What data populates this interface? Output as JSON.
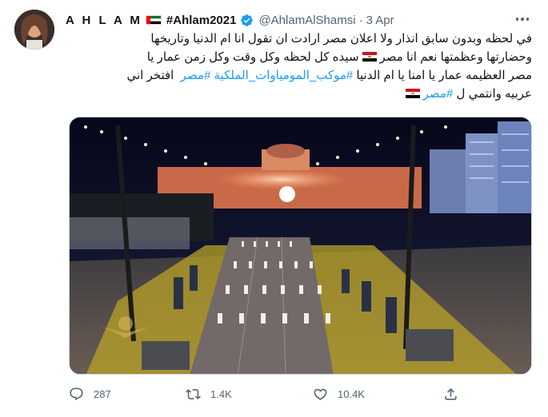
{
  "author": {
    "display_name": "A H L A M",
    "name_hashtag": "#Ahlam2021",
    "handle": "@AhlamAlShamsi",
    "date": "3 Apr",
    "verified": true
  },
  "tweet": {
    "line1": "في لحظه وبدون سابق انذار ولا اعلان مصر ارادت  ان تقول انا ام الدنيا وتاريخها",
    "line2a": "وحضارتها وعظمتها نعم انا مصر",
    "line2b": "سيده كل لحظه وكل وقت وكل زمن عمار يا",
    "line3a": "مصر العظيمه عمار يا امنا يا ام الدنيا",
    "line3_tag1": "#موكب_المومياوات_الملكية",
    "line3_tag2": "#مصر",
    "line3b": "افتخر اني",
    "line4a": "عربيه وانتمي ل",
    "line4_tag": "#مصر"
  },
  "media": {
    "type": "photo",
    "description_icon": "photo"
  },
  "actions": {
    "reply_count": "287",
    "retweet_count": "1.4K",
    "like_count": "10.4K"
  },
  "colors": {
    "link": "#1d9bf0",
    "secondary": "#536471",
    "verified": "#1d9bf0"
  }
}
